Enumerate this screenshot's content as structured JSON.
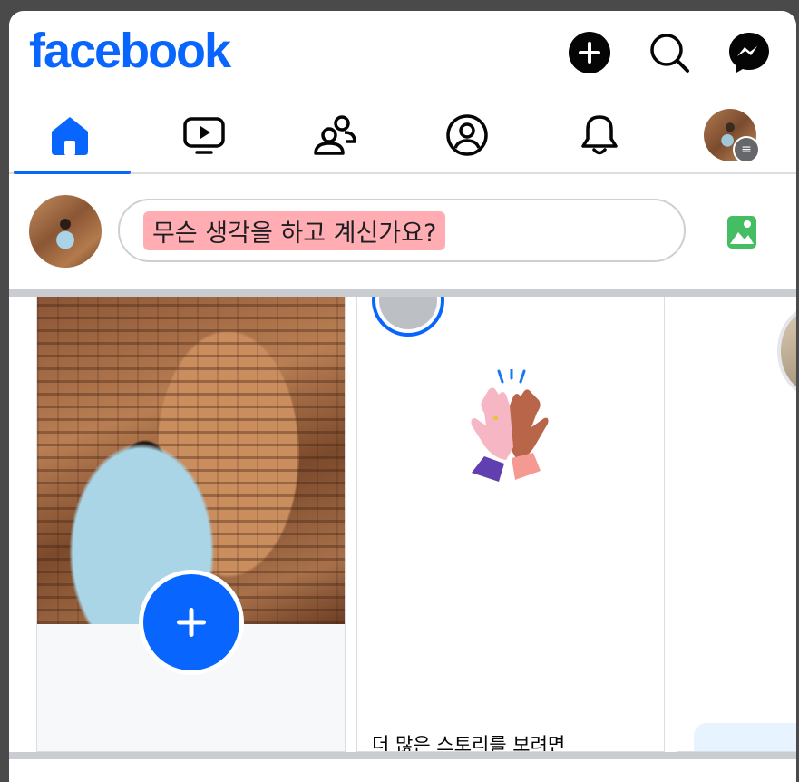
{
  "header": {
    "logo_text": "facebook",
    "icons": [
      "plus-icon",
      "search-icon",
      "messenger-icon"
    ]
  },
  "nav": {
    "items": [
      {
        "name": "home",
        "icon": "home-icon",
        "active": true
      },
      {
        "name": "video",
        "icon": "video-icon",
        "active": false
      },
      {
        "name": "friends",
        "icon": "friends-icon",
        "active": false
      },
      {
        "name": "profile",
        "icon": "profile-icon",
        "active": false
      },
      {
        "name": "notifications",
        "icon": "bell-icon",
        "active": false
      },
      {
        "name": "menu",
        "icon": "menu-icon",
        "active": false
      }
    ]
  },
  "composer": {
    "placeholder": "무슨 생각을 하고 계신가요?",
    "photo_icon": "photo-icon"
  },
  "stories": {
    "more_text": "더 많은 스토리를 보려면"
  },
  "colors": {
    "brand": "#0866ff",
    "photo_green": "#45bd62",
    "highlight": "#ff6973"
  }
}
